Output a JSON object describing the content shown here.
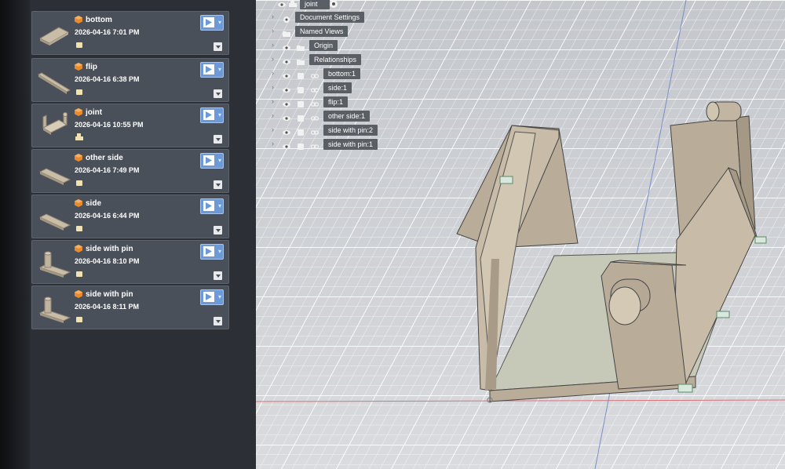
{
  "panel": {
    "items": [
      {
        "name": "bottom",
        "date": "2026-04-16 7:01 PM",
        "thumb": "plate-icon"
      },
      {
        "name": "flip",
        "date": "2026-04-16 6:38 PM",
        "thumb": "bar-icon"
      },
      {
        "name": "joint",
        "date": "2026-04-16 10:55 PM",
        "thumb": "assembly-icon"
      },
      {
        "name": "other side",
        "date": "2026-04-16 7:49 PM",
        "thumb": "plate-icon"
      },
      {
        "name": "side",
        "date": "2026-04-16 6:44 PM",
        "thumb": "plate-icon"
      },
      {
        "name": "side with pin",
        "date": "2026-04-16 8:10 PM",
        "thumb": "pin-plate-icon"
      },
      {
        "name": "side with pin",
        "date": "2026-04-16 8:11 PM",
        "thumb": "pin-plate-icon"
      }
    ]
  },
  "browser": {
    "root": "joint",
    "nodes": [
      {
        "label": "Document Settings",
        "icon": "gear-icon"
      },
      {
        "label": "Named Views",
        "icon": "folder-icon"
      },
      {
        "label": "Origin",
        "icon": "folder-icon"
      },
      {
        "label": "Relationships",
        "icon": "folder-icon"
      },
      {
        "label": "bottom:1",
        "icon": "link-icon"
      },
      {
        "label": "side:1",
        "icon": "link-icon"
      },
      {
        "label": "flip:1",
        "icon": "link-icon"
      },
      {
        "label": "other side:1",
        "icon": "link-icon"
      },
      {
        "label": "side with pin:2",
        "icon": "link-icon"
      },
      {
        "label": "side with pin:1",
        "icon": "link-icon"
      }
    ]
  },
  "colors": {
    "accent": "#6c9ad8",
    "card": "#4a5059",
    "panel": "#2c3036",
    "model": "#b9ad9a",
    "icon_orange": "#e98a2f"
  }
}
